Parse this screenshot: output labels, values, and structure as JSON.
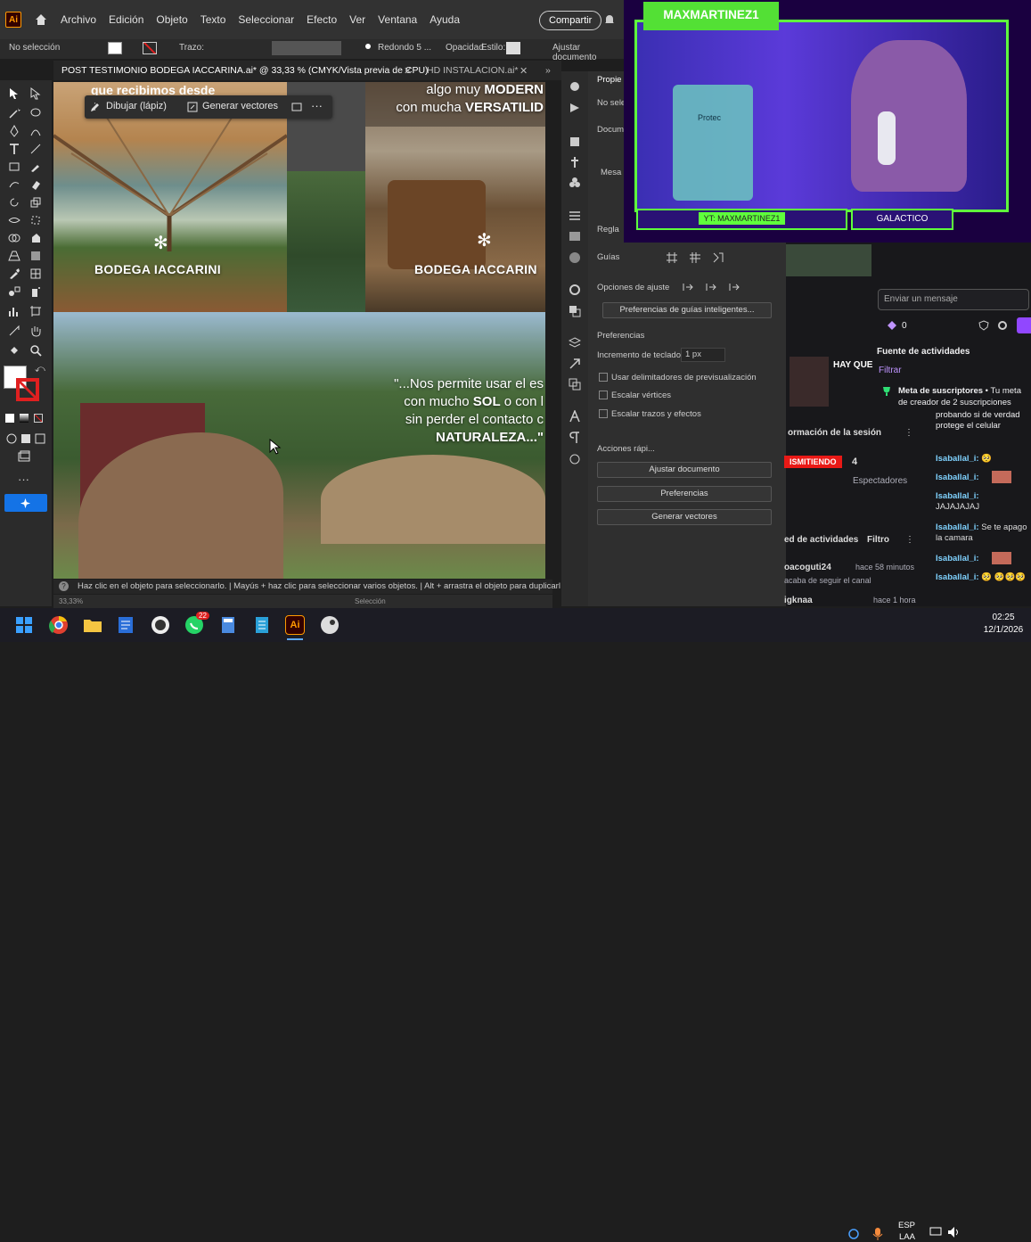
{
  "app": {
    "logo": "Ai",
    "menu": [
      "Archivo",
      "Edición",
      "Objeto",
      "Texto",
      "Seleccionar",
      "Efecto",
      "Ver",
      "Ventana",
      "Ayuda"
    ],
    "share_label": "Compartir"
  },
  "control_bar": {
    "selection": "No selección",
    "stroke_label": "Trazo:",
    "brush": "Redondo 5 ...",
    "opacity_label": "Opacidad",
    "style_label": "Estilo:",
    "adjust_doc": "Ajustar documento"
  },
  "tabs": [
    {
      "label": "POST TESTIMONIO BODEGA IACCARINA.ai* @ 33,33 % (CMYK/Vista previa de CPU)",
      "active": true
    },
    {
      "label": "HD INSTALACION.ai*",
      "active": false
    }
  ],
  "canvas": {
    "top_text": "que recibimos desde",
    "draw_pencil": "Dibujar (lápiz)",
    "generate_vectors": "Generar vectores",
    "brand_left": "BODEGA IACCARINI",
    "brand_right": "BODEGA IACCARIN",
    "right_headline_1a": "algo muy ",
    "right_headline_1b": "MODERN",
    "right_headline_2a": "con mucha ",
    "right_headline_2b": "VERSATILID",
    "quote_1": "\"...Nos permite usar el es",
    "quote_2a": "con mucho ",
    "quote_2b": "SOL",
    "quote_2c": " o con l",
    "quote_3": "sin perder el contacto c",
    "quote_4": "NATURALEZA...\""
  },
  "status": {
    "hint": "Haz clic en el objeto para seleccionarlo.  |  Mayús + haz clic para seleccionar varios objetos.  |  Alt + arrastra el objeto para duplicarl",
    "zoom": "33,33%",
    "mode": "Selección"
  },
  "properties": {
    "title": "Propie",
    "no_sel": "No sele",
    "document": "Docume",
    "mesa": "Mesa",
    "rulers": "Regla",
    "guides": "Guías",
    "snap_options": "Opciones de ajuste",
    "smart_guides_pref": "Preferencias de guías inteligentes...",
    "preferences": "Preferencias",
    "keyboard_increment_label": "Incremento de teclado:",
    "keyboard_increment_value": "1 px",
    "use_preview_bounds": "Usar delimitadores de previsualización",
    "scale_corners": "Escalar vértices",
    "scale_strokes": "Escalar trazos y efectos",
    "quick_actions": "Acciones rápi...",
    "btn_adjust_doc": "Ajustar documento",
    "btn_preferences": "Preferencias",
    "btn_generate_vectors": "Generar vectores"
  },
  "stream": {
    "streamer": "MAXMARTINEZ1",
    "yt_badge": "YT: MAXMARTINEZ1",
    "badge2": "GALACTICO",
    "mug_label": "Protec"
  },
  "twitch": {
    "message_placeholder": "Enviar un mensaje",
    "points": "0",
    "activity_source": "Fuente de actividades",
    "filter": "Filtrar",
    "goal": "Meta de suscriptores",
    "goal_rest": " • Tu meta de creador de 2 suscripciones",
    "session_info": "ormación de la sesión",
    "live_badge": "ISMITIENDO",
    "viewers_count": "4",
    "viewers_label": "Espectadores",
    "activity_feed": "ed de actividades",
    "filter2": "Filtro",
    "feed_user1": "oacoguti24",
    "feed_time1": "hace 58 minutos",
    "feed_note1": "acaba de seguir el canal",
    "feed_user2": "igknaa",
    "feed_time2": "hace 1 hora",
    "promo_title": "HAY QUE",
    "chat": [
      {
        "name": "",
        "text": "probando si de verdad protege el celular"
      },
      {
        "name": "Isaballal_i:",
        "text": "🥺"
      },
      {
        "name": "Isaballal_i:",
        "text": ""
      },
      {
        "name": "Isaballal_i:",
        "text": "JAJAJAJAJ"
      },
      {
        "name": "Isaballal_i:",
        "text": "Se te apago la camara"
      },
      {
        "name": "Isaballal_i:",
        "text": ""
      },
      {
        "name": "Isaballal_i:",
        "text": "🥺 🥺🥺🥺"
      }
    ]
  },
  "taskbar": {
    "lang1": "ESP",
    "lang2": "LAA",
    "time": "02:25",
    "date": "12/1/2026",
    "whatsapp_badge": "22"
  }
}
